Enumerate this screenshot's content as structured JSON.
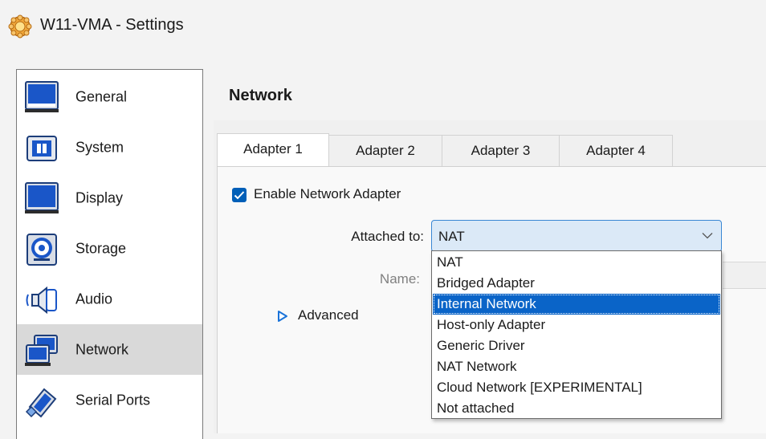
{
  "window": {
    "title": "W11-VMA - Settings",
    "icon": "virtualbox-gear-icon"
  },
  "sidebar": {
    "items": [
      {
        "label": "General",
        "icon": "general-monitor-icon",
        "selected": false
      },
      {
        "label": "System",
        "icon": "system-chip-icon",
        "selected": false
      },
      {
        "label": "Display",
        "icon": "display-monitor-icon",
        "selected": false
      },
      {
        "label": "Storage",
        "icon": "storage-disc-icon",
        "selected": false
      },
      {
        "label": "Audio",
        "icon": "audio-speaker-icon",
        "selected": false
      },
      {
        "label": "Network",
        "icon": "network-monitors-icon",
        "selected": true
      },
      {
        "label": "Serial Ports",
        "icon": "serial-port-icon",
        "selected": false
      }
    ]
  },
  "main": {
    "section_title": "Network",
    "tabs": [
      {
        "label": "Adapter 1",
        "active": true
      },
      {
        "label": "Adapter 2",
        "active": false
      },
      {
        "label": "Adapter 3",
        "active": false
      },
      {
        "label": "Adapter 4",
        "active": false
      }
    ],
    "enable_adapter": {
      "label": "Enable Network Adapter",
      "checked": true
    },
    "attached_to": {
      "label": "Attached to:",
      "value": "NAT"
    },
    "name": {
      "label": "Name:"
    },
    "advanced": {
      "label": "Advanced"
    }
  },
  "dropdown": {
    "options": [
      "NAT",
      "Bridged Adapter",
      "Internal Network",
      "Host-only Adapter",
      "Generic Driver",
      "NAT Network",
      "Cloud Network [EXPERIMENTAL]",
      "Not attached"
    ],
    "highlighted": "Internal Network"
  },
  "colors": {
    "accent": "#005fb8",
    "highlight": "#0a64c8",
    "combo_bg": "#dbe9f7",
    "sidebar_selected": "#d9d9d9"
  }
}
